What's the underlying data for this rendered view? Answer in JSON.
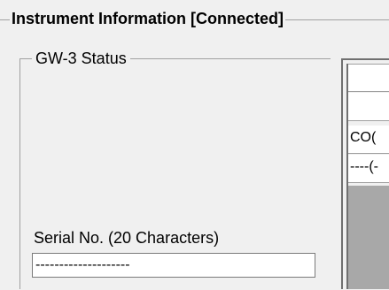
{
  "instrument_group": {
    "title": "Instrument Information [Connected]"
  },
  "status_group": {
    "title": "GW-3 Status"
  },
  "serial": {
    "label": "Serial No. (20 Characters)",
    "value": "--------------------"
  },
  "table": {
    "rows": [
      "",
      "",
      "CO(",
      "----(-"
    ]
  }
}
